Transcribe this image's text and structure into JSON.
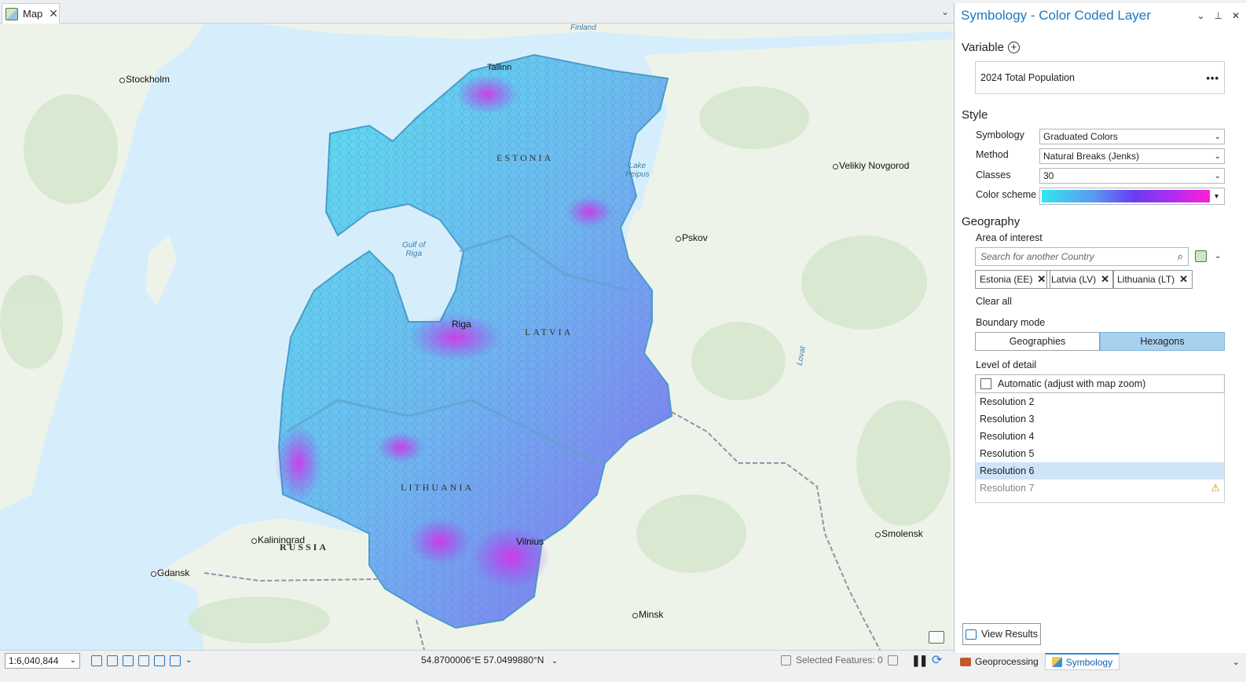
{
  "map_tab": {
    "label": "Map",
    "icon": "map-icon"
  },
  "map": {
    "places": [
      {
        "name": "Stockholm",
        "key": "stockholm"
      },
      {
        "name": "Tallinn",
        "key": "tallinn"
      },
      {
        "name": "Velikiy Novgorod",
        "key": "novgorod"
      },
      {
        "name": "Pskov",
        "key": "pskov"
      },
      {
        "name": "Riga",
        "key": "riga"
      },
      {
        "name": "Kaliningrad",
        "key": "kaliningrad"
      },
      {
        "name": "Gdansk",
        "key": "gdansk"
      },
      {
        "name": "Vilnius",
        "key": "vilnius"
      },
      {
        "name": "Smolensk",
        "key": "smolensk"
      },
      {
        "name": "Minsk",
        "key": "minsk"
      }
    ],
    "water_labels": {
      "finland": "Finland",
      "peipus": "Lake\nPeipus",
      "riga_gulf": "Gulf of\nRiga",
      "lovat": "Lovat"
    },
    "countries": {
      "estonia": "ESTONIA",
      "latvia": "LATVIA",
      "lithuania": "LITHUANIA",
      "russia": "RUSSIA"
    }
  },
  "statusbar": {
    "scale": "1:6,040,844",
    "coordinates": "54.8700006°E 57.0499880°N",
    "selected_features": "Selected Features: 0"
  },
  "pane": {
    "title": "Symbology - Color Coded Layer",
    "variable": {
      "heading": "Variable",
      "value": "2024 Total Population"
    },
    "style": {
      "heading": "Style",
      "symbology_label": "Symbology",
      "symbology_value": "Graduated Colors",
      "method_label": "Method",
      "method_value": "Natural Breaks (Jenks)",
      "classes_label": "Classes",
      "classes_value": "30",
      "scheme_label": "Color scheme"
    },
    "geography": {
      "heading": "Geography",
      "aoi_label": "Area of interest",
      "search_placeholder": "Search for another Country",
      "chips": [
        "Estonia (EE)",
        "Latvia (LV)",
        "Lithuania (LT)"
      ],
      "clear_all": "Clear all",
      "boundary_label": "Boundary mode",
      "boundary_options": [
        "Geographies",
        "Hexagons"
      ],
      "boundary_selected": "Hexagons",
      "lod_label": "Level of detail",
      "automatic": "Automatic (adjust with map zoom)",
      "resolutions": [
        "Resolution 2",
        "Resolution 3",
        "Resolution 4",
        "Resolution 5",
        "Resolution 6",
        "Resolution 7"
      ],
      "selected_resolution": "Resolution 6"
    },
    "view_results": "View Results"
  },
  "pane_tabs": {
    "geoprocessing": "Geoprocessing",
    "symbology": "Symbology"
  },
  "colors": {
    "accent": "#1a78c2",
    "ramp_start": "#31e7ef",
    "ramp_mid": "#6a3cf2",
    "ramp_end": "#ff1fd6"
  }
}
